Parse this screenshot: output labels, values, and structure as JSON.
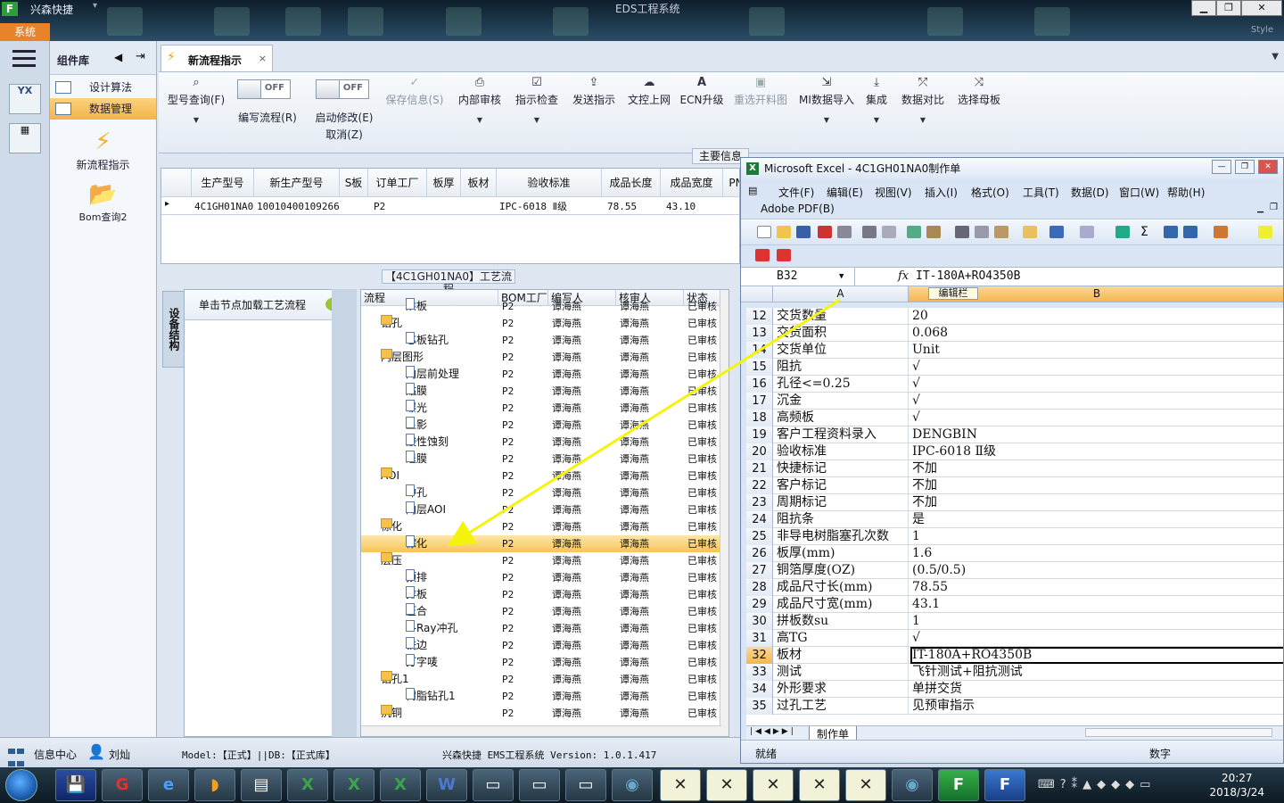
{
  "app": {
    "name": "兴森快捷",
    "window_title": "EDS工程系统",
    "style_label": "Style",
    "system_tab": "系统"
  },
  "left_strip": {
    "yx_label": "YX"
  },
  "component_panel": {
    "title": "组件库",
    "items": [
      {
        "label": "设计算法",
        "active": false
      },
      {
        "label": "数据管理",
        "active": true
      }
    ],
    "big_items": [
      {
        "label": "新流程指示",
        "icon": "lightning-icon"
      },
      {
        "label": "Bom查询2",
        "icon": "folder-icon"
      }
    ]
  },
  "doc_tab": {
    "label": "新流程指示",
    "close": "×"
  },
  "ribbon": {
    "items": [
      {
        "label": "型号查询(F)",
        "icon": "search-icon",
        "disabled": false,
        "caret": true
      },
      {
        "label": "编写流程(R)",
        "type": "toggle",
        "state": "OFF"
      },
      {
        "label": "启动修改(E)",
        "sub": "取消(Z)",
        "type": "toggle",
        "state": "OFF"
      },
      {
        "label": "保存信息(S)",
        "icon": "check-icon",
        "disabled": true,
        "caret": false
      },
      {
        "label": "内部审核",
        "icon": "print-icon",
        "disabled": false,
        "caret": true
      },
      {
        "label": "指示检查",
        "icon": "checkbox-icon",
        "disabled": false,
        "caret": true
      },
      {
        "label": "发送指示",
        "icon": "upload-icon",
        "disabled": false,
        "caret": false
      },
      {
        "label": "文控上网",
        "icon": "cloud-upload-icon",
        "disabled": false,
        "caret": false
      },
      {
        "label": "ECN升级",
        "icon": "font-a-icon",
        "disabled": false,
        "caret": false
      },
      {
        "label": "重选开料图",
        "icon": "image-icon",
        "disabled": true,
        "caret": false
      },
      {
        "label": "MI数据导入",
        "icon": "import-icon",
        "disabled": false,
        "caret": true
      },
      {
        "label": "集成",
        "icon": "download-icon",
        "disabled": false,
        "caret": true
      },
      {
        "label": "数据对比",
        "icon": "compare-icon",
        "disabled": false,
        "caret": true
      },
      {
        "label": "选择母板",
        "icon": "shuffle-icon",
        "disabled": false,
        "caret": false
      }
    ]
  },
  "main_info_label": "主要信息",
  "grid1": {
    "headers": [
      "生产型号",
      "新生产型号",
      "S板",
      "订单工厂",
      "板厚",
      "板材",
      "验收标准",
      "成品长度",
      "成品宽度",
      "PN"
    ],
    "row": [
      "4C1GH01NA0",
      "10010400109266",
      "",
      "P2",
      "",
      "",
      "IPC-6018 Ⅱ级",
      "78.55",
      "43.10",
      ""
    ]
  },
  "process": {
    "title": "【4C1GH01NA0】工艺流程",
    "side_tab": "设备结构",
    "load_hint": "单击节点加载工艺流程",
    "columns": [
      "流程",
      "BOM工厂",
      "编写人",
      "核审人",
      "状态"
    ],
    "rows": [
      {
        "name": "烘板",
        "level": 2,
        "folder": false,
        "factory": "P2",
        "writer": "谭海燕",
        "checker": "谭海燕",
        "status": "已审核"
      },
      {
        "name": "钻孔",
        "level": 1,
        "folder": true,
        "factory": "P2",
        "writer": "谭海燕",
        "checker": "谭海燕",
        "status": "已审核"
      },
      {
        "name": "芯板钻孔",
        "level": 2,
        "folder": false,
        "factory": "P2",
        "writer": "谭海燕",
        "checker": "谭海燕",
        "status": "已审核"
      },
      {
        "name": "内层图形",
        "level": 1,
        "folder": true,
        "factory": "P2",
        "writer": "谭海燕",
        "checker": "谭海燕",
        "status": "已审核"
      },
      {
        "name": "内层前处理",
        "level": 2,
        "folder": false,
        "factory": "P2",
        "writer": "谭海燕",
        "checker": "谭海燕",
        "status": "已审核"
      },
      {
        "name": "贴膜",
        "level": 2,
        "folder": false,
        "factory": "P2",
        "writer": "谭海燕",
        "checker": "谭海燕",
        "status": "已审核"
      },
      {
        "name": "曝光",
        "level": 2,
        "folder": false,
        "factory": "P2",
        "writer": "谭海燕",
        "checker": "谭海燕",
        "status": "已审核"
      },
      {
        "name": "显影",
        "level": 2,
        "folder": false,
        "factory": "P2",
        "writer": "谭海燕",
        "checker": "谭海燕",
        "status": "已审核"
      },
      {
        "name": "酸性蚀刻",
        "level": 2,
        "folder": false,
        "factory": "P2",
        "writer": "谭海燕",
        "checker": "谭海燕",
        "status": "已审核"
      },
      {
        "name": "退膜",
        "level": 2,
        "folder": false,
        "factory": "P2",
        "writer": "谭海燕",
        "checker": "谭海燕",
        "status": "已审核"
      },
      {
        "name": "AOI",
        "level": 1,
        "folder": true,
        "factory": "P2",
        "writer": "谭海燕",
        "checker": "谭海燕",
        "status": "已审核"
      },
      {
        "name": "冲孔",
        "level": 2,
        "folder": false,
        "factory": "P2",
        "writer": "谭海燕",
        "checker": "谭海燕",
        "status": "已审核"
      },
      {
        "name": "内层AOI",
        "level": 2,
        "folder": false,
        "factory": "P2",
        "writer": "谭海燕",
        "checker": "谭海燕",
        "status": "已审核"
      },
      {
        "name": "棕化",
        "level": 1,
        "folder": true,
        "factory": "P2",
        "writer": "谭海燕",
        "checker": "谭海燕",
        "status": "已审核"
      },
      {
        "name": "棕化",
        "level": 2,
        "folder": false,
        "factory": "P2",
        "writer": "谭海燕",
        "checker": "谭海燕",
        "status": "已审核",
        "selected": true
      },
      {
        "name": "层压",
        "level": 1,
        "folder": true,
        "factory": "P2",
        "writer": "谭海燕",
        "checker": "谭海燕",
        "status": "已审核"
      },
      {
        "name": "预排",
        "level": 2,
        "folder": false,
        "factory": "P2",
        "writer": "谭海燕",
        "checker": "谭海燕",
        "status": "已审核"
      },
      {
        "name": "排板",
        "level": 2,
        "folder": false,
        "factory": "P2",
        "writer": "谭海燕",
        "checker": "谭海燕",
        "status": "已审核"
      },
      {
        "name": "压合",
        "level": 2,
        "folder": false,
        "factory": "P2",
        "writer": "谭海燕",
        "checker": "谭海燕",
        "status": "已审核"
      },
      {
        "name": "X-Ray冲孔",
        "level": 2,
        "folder": false,
        "factory": "P2",
        "writer": "谭海燕",
        "checker": "谭海燕",
        "status": "已审核"
      },
      {
        "name": "铣边",
        "level": 2,
        "folder": false,
        "factory": "P2",
        "writer": "谭海燕",
        "checker": "谭海燕",
        "status": "已审核"
      },
      {
        "name": "打字唛",
        "level": 2,
        "folder": false,
        "factory": "P2",
        "writer": "谭海燕",
        "checker": "谭海燕",
        "status": "已审核"
      },
      {
        "name": "钻孔1",
        "level": 1,
        "folder": true,
        "factory": "P2",
        "writer": "谭海燕",
        "checker": "谭海燕",
        "status": "已审核"
      },
      {
        "name": "树脂钻孔1",
        "level": 2,
        "folder": false,
        "factory": "P2",
        "writer": "谭海燕",
        "checker": "谭海燕",
        "status": "已审核"
      },
      {
        "name": "沉铜",
        "level": 1,
        "folder": true,
        "factory": "P2",
        "writer": "谭海燕",
        "checker": "谭海燕",
        "status": "已审核"
      }
    ]
  },
  "statusbar": {
    "info_center": "信息中心",
    "user": "刘灿",
    "model_text": "Model:【正式】||DB:【正式库】",
    "version_text": "兴森快捷 EMS工程系统 Version: 1.0.1.417"
  },
  "excel": {
    "title": "Microsoft Excel - 4C1GH01NA0制作单",
    "menu": [
      "文件(F)",
      "编辑(E)",
      "视图(V)",
      "插入(I)",
      "格式(O)",
      "工具(T)",
      "数据(D)",
      "窗口(W)",
      "帮助(H)"
    ],
    "adobe": "Adobe PDF(B)",
    "name_box": "B32",
    "fx": "fx",
    "formula": "IT-180A+RO4350B",
    "col_a": "A",
    "col_b": "B",
    "col_b_tag": "编辑栏",
    "rows": [
      {
        "n": "12",
        "a": "交货数量",
        "b": "20"
      },
      {
        "n": "13",
        "a": "交货面积",
        "b": "0.068"
      },
      {
        "n": "14",
        "a": "交货单位",
        "b": "Unit"
      },
      {
        "n": "15",
        "a": "阻抗",
        "b": "√"
      },
      {
        "n": "16",
        "a": "孔径<=0.25",
        "b": "√"
      },
      {
        "n": "17",
        "a": "沉金",
        "b": "√"
      },
      {
        "n": "18",
        "a": "高频板",
        "b": "√"
      },
      {
        "n": "19",
        "a": "客户工程资料录入",
        "b": "DENGBIN"
      },
      {
        "n": "20",
        "a": "验收标准",
        "b": "IPC-6018 Ⅱ级"
      },
      {
        "n": "21",
        "a": "快捷标记",
        "b": "不加"
      },
      {
        "n": "22",
        "a": "客户标记",
        "b": "不加"
      },
      {
        "n": "23",
        "a": "周期标记",
        "b": "不加"
      },
      {
        "n": "24",
        "a": "阻抗条",
        "b": "是"
      },
      {
        "n": "25",
        "a": "非导电树脂塞孔次数",
        "b": "1"
      },
      {
        "n": "26",
        "a": "板厚(mm)",
        "b": "1.6"
      },
      {
        "n": "27",
        "a": "铜箔厚度(OZ)",
        "b": "(0.5/0.5)"
      },
      {
        "n": "28",
        "a": "成品尺寸长(mm)",
        "b": "78.55"
      },
      {
        "n": "29",
        "a": "成品尺寸宽(mm)",
        "b": "43.1"
      },
      {
        "n": "30",
        "a": "拼板数su",
        "b": "1"
      },
      {
        "n": "31",
        "a": "高TG",
        "b": "√"
      },
      {
        "n": "32",
        "a": "板材",
        "b": "IT-180A+RO4350B",
        "selected": true
      },
      {
        "n": "33",
        "a": "测试",
        "b": "飞针测试+阻抗测试"
      },
      {
        "n": "34",
        "a": "外形要求",
        "b": "单拼交货"
      },
      {
        "n": "35",
        "a": "过孔工艺",
        "b": "见预审指示"
      }
    ],
    "sheet_tab": "制作单",
    "status_ready": "就绪",
    "status_num": "数字"
  },
  "taskbar": {
    "time": "20:27",
    "date": "2018/3/24"
  }
}
